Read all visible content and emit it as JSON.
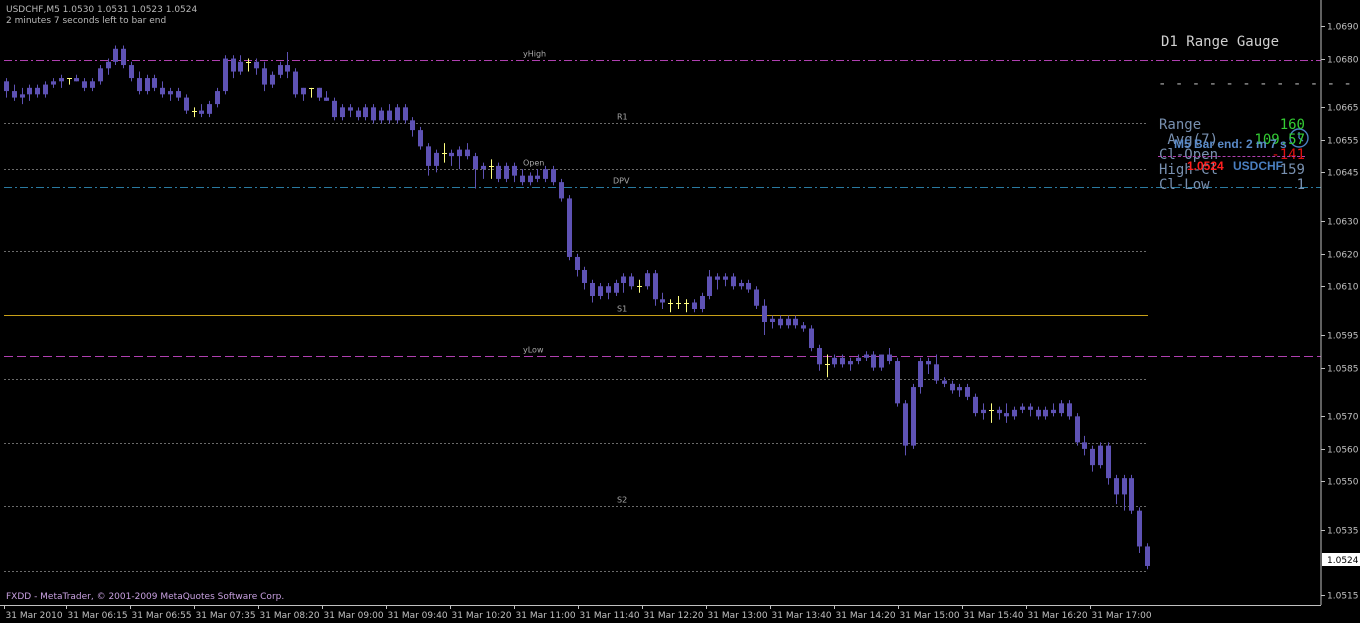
{
  "header": {
    "symbol_line": "USDCHF,M5  1.0530 1.0531 1.0523 1.0524",
    "countdown": "2 minutes 7 seconds left to bar end"
  },
  "footer": {
    "copyright": "FXDD - MetaTrader, © 2001-2009 MetaQuotes Software Corp."
  },
  "gauge": {
    "title": "D1 Range Gauge",
    "rows": [
      {
        "label": "Range",
        "value": "160",
        "color": "#33cc33"
      },
      {
        "label": " Avg(7)",
        "value": "109.57",
        "color": "#33cc33"
      },
      {
        "label": "Cl-Open",
        "value": "-141",
        "color": "#e01010",
        "strike": true
      },
      {
        "label": "High-Cl",
        "value": "159",
        "color": "#7890b0"
      },
      {
        "label": "Cl-Low",
        "value": "1",
        "color": "#7890b0"
      }
    ]
  },
  "bar_info": {
    "bar_end": "M5 Bar end: 2 m 7 s",
    "price": "1.0524",
    "symbol": "USDCHF",
    "clock_icon": "clock-icon"
  },
  "colors": {
    "background": "#000000",
    "candle": "#5e52b4",
    "doji": "#ffff80",
    "grid": "#6a6a6a",
    "pivot": "#c8a018",
    "range_line": "#b040b0",
    "dpv_line": "#2a7aa0",
    "axis": "#c0c0c0"
  },
  "chart_data": {
    "type": "candlestick",
    "timeframe": "M5",
    "symbol": "USDCHF",
    "ylim": [
      1.0512,
      1.0698
    ],
    "y_ticks": [
      "1.0690",
      "1.0680",
      "1.0665",
      "1.0655",
      "1.0645",
      "1.0630",
      "1.0620",
      "1.0610",
      "1.0595",
      "1.0585",
      "1.0570",
      "1.0560",
      "1.0550",
      "1.0535",
      "1.0515"
    ],
    "current_price": "1.0524",
    "x_tick_labels": [
      "31 Mar 2010",
      "31 Mar 06:15",
      "31 Mar 06:55",
      "31 Mar 07:35",
      "31 Mar 08:20",
      "31 Mar 09:00",
      "31 Mar 09:40",
      "31 Mar 10:20",
      "31 Mar 11:00",
      "31 Mar 11:40",
      "31 Mar 12:20",
      "31 Mar 13:00",
      "31 Mar 13:40",
      "31 Mar 14:20",
      "31 Mar 15:00",
      "31 Mar 15:40",
      "31 Mar 16:20",
      "31 Mar 17:00"
    ],
    "levels": [
      {
        "label": "R1",
        "price": 1.06602,
        "style": "dotted",
        "color": "#6a6a6a"
      },
      {
        "label": "yHigh",
        "price": 1.06795,
        "style": "dashdot",
        "color": "#b040b0"
      },
      {
        "label": "Open",
        "price": 1.0646,
        "style": "dotted",
        "color": "#6a6a6a"
      },
      {
        "label": "DPV",
        "price": 1.06405,
        "style": "dashdot",
        "color": "#2a7aa0"
      },
      {
        "label": "",
        "price": 1.06208,
        "style": "dotted",
        "color": "#6a6a6a"
      },
      {
        "label": "S1",
        "price": 1.06012,
        "style": "solid",
        "color": "#c8a018"
      },
      {
        "label": "yLow",
        "price": 1.05885,
        "style": "dashed",
        "color": "#b040b0"
      },
      {
        "label": "",
        "price": 1.05815,
        "style": "dotted",
        "color": "#6a6a6a"
      },
      {
        "label": "",
        "price": 1.05617,
        "style": "dotted",
        "color": "#6a6a6a"
      },
      {
        "label": "S2",
        "price": 1.05423,
        "style": "dotted",
        "color": "#6a6a6a"
      },
      {
        "label": "",
        "price": 1.05225,
        "style": "dotted",
        "color": "#6a6a6a"
      }
    ],
    "candles": [
      [
        1.0673,
        1.0674,
        1.0668,
        1.067
      ],
      [
        1.067,
        1.0672,
        1.0667,
        1.0668
      ],
      [
        1.0668,
        1.0671,
        1.0666,
        1.0669
      ],
      [
        1.0669,
        1.0672,
        1.0667,
        1.0671
      ],
      [
        1.0671,
        1.0672,
        1.0668,
        1.0669
      ],
      [
        1.0669,
        1.0673,
        1.0668,
        1.0672
      ],
      [
        1.0672,
        1.0674,
        1.0671,
        1.0673
      ],
      [
        1.0673,
        1.0675,
        1.0671,
        1.0674
      ],
      [
        1.0674,
        1.0674,
        1.0672,
        1.0674
      ],
      [
        1.0674,
        1.0675,
        1.0673,
        1.0673
      ],
      [
        1.0673,
        1.0674,
        1.067,
        1.0671
      ],
      [
        1.0671,
        1.0674,
        1.067,
        1.0673
      ],
      [
        1.0673,
        1.0678,
        1.0672,
        1.0677
      ],
      [
        1.0677,
        1.068,
        1.0675,
        1.0679
      ],
      [
        1.0679,
        1.0684,
        1.0678,
        1.0683
      ],
      [
        1.0683,
        1.0684,
        1.0677,
        1.0678
      ],
      [
        1.0678,
        1.0679,
        1.0673,
        1.0674
      ],
      [
        1.0674,
        1.0676,
        1.0669,
        1.067
      ],
      [
        1.067,
        1.0675,
        1.0669,
        1.0674
      ],
      [
        1.0674,
        1.0675,
        1.067,
        1.0671
      ],
      [
        1.0671,
        1.0673,
        1.0668,
        1.0669
      ],
      [
        1.0669,
        1.0671,
        1.0667,
        1.067
      ],
      [
        1.067,
        1.0671,
        1.0667,
        1.0668
      ],
      [
        1.0668,
        1.0669,
        1.0663,
        1.0664
      ],
      [
        1.0664,
        1.0665,
        1.0662,
        1.0664
      ],
      [
        1.0664,
        1.0666,
        1.0662,
        1.0663
      ],
      [
        1.0663,
        1.0667,
        1.0662,
        1.0666
      ],
      [
        1.0666,
        1.0671,
        1.0665,
        1.067
      ],
      [
        1.067,
        1.0681,
        1.0669,
        1.068
      ],
      [
        1.068,
        1.0681,
        1.0674,
        1.0676
      ],
      [
        1.0676,
        1.0681,
        1.0675,
        1.0679
      ],
      [
        1.0679,
        1.068,
        1.0676,
        1.0679
      ],
      [
        1.0679,
        1.068,
        1.0675,
        1.0677
      ],
      [
        1.0677,
        1.0679,
        1.067,
        1.0672
      ],
      [
        1.0672,
        1.0676,
        1.0671,
        1.0675
      ],
      [
        1.0675,
        1.0679,
        1.0674,
        1.0678
      ],
      [
        1.0678,
        1.0682,
        1.0674,
        1.0676
      ],
      [
        1.0676,
        1.0677,
        1.0668,
        1.0669
      ],
      [
        1.0669,
        1.0671,
        1.0667,
        1.0671
      ],
      [
        1.0671,
        1.0671,
        1.0668,
        1.0671
      ],
      [
        1.0671,
        1.0671,
        1.0667,
        1.0668
      ],
      [
        1.0668,
        1.067,
        1.0667,
        1.0667
      ],
      [
        1.0667,
        1.0668,
        1.0661,
        1.0662
      ],
      [
        1.0662,
        1.0666,
        1.0661,
        1.0665
      ],
      [
        1.0665,
        1.0666,
        1.0662,
        1.0664
      ],
      [
        1.0664,
        1.0665,
        1.0661,
        1.0662
      ],
      [
        1.0662,
        1.0666,
        1.0661,
        1.0665
      ],
      [
        1.0665,
        1.0666,
        1.066,
        1.0661
      ],
      [
        1.0661,
        1.0665,
        1.066,
        1.0664
      ],
      [
        1.0664,
        1.0666,
        1.066,
        1.0661
      ],
      [
        1.0661,
        1.0666,
        1.066,
        1.0665
      ],
      [
        1.0665,
        1.0666,
        1.066,
        1.0661
      ],
      [
        1.0661,
        1.0662,
        1.0656,
        1.0658
      ],
      [
        1.0658,
        1.0659,
        1.0652,
        1.0653
      ],
      [
        1.0653,
        1.0654,
        1.0644,
        1.0647
      ],
      [
        1.0647,
        1.0652,
        1.0645,
        1.0651
      ],
      [
        1.0651,
        1.0654,
        1.0648,
        1.0651
      ],
      [
        1.0651,
        1.0652,
        1.0647,
        1.065
      ],
      [
        1.065,
        1.0653,
        1.0646,
        1.0652
      ],
      [
        1.0652,
        1.0654,
        1.0649,
        1.065
      ],
      [
        1.065,
        1.0651,
        1.064,
        1.0646
      ],
      [
        1.0646,
        1.0648,
        1.0643,
        1.0647
      ],
      [
        1.0647,
        1.0649,
        1.0643,
        1.0647
      ],
      [
        1.0647,
        1.0648,
        1.0642,
        1.0643
      ],
      [
        1.0643,
        1.0648,
        1.0642,
        1.0647
      ],
      [
        1.0647,
        1.0648,
        1.0642,
        1.0644
      ],
      [
        1.0644,
        1.0646,
        1.0641,
        1.0642
      ],
      [
        1.0642,
        1.0645,
        1.0641,
        1.0644
      ],
      [
        1.0644,
        1.0646,
        1.0642,
        1.0643
      ],
      [
        1.0643,
        1.0647,
        1.0642,
        1.0646
      ],
      [
        1.0646,
        1.0647,
        1.0641,
        1.0642
      ],
      [
        1.0642,
        1.0643,
        1.0636,
        1.0637
      ],
      [
        1.0637,
        1.0638,
        1.0618,
        1.0619
      ],
      [
        1.0619,
        1.062,
        1.0613,
        1.0615
      ],
      [
        1.0615,
        1.0616,
        1.0609,
        1.0611
      ],
      [
        1.0611,
        1.0612,
        1.0605,
        1.0607
      ],
      [
        1.0607,
        1.0611,
        1.0606,
        1.061
      ],
      [
        1.061,
        1.0611,
        1.0606,
        1.0608
      ],
      [
        1.0608,
        1.0612,
        1.0607,
        1.0611
      ],
      [
        1.0611,
        1.0614,
        1.0608,
        1.0613
      ],
      [
        1.0613,
        1.0614,
        1.0609,
        1.061
      ],
      [
        1.061,
        1.0612,
        1.0608,
        1.061
      ],
      [
        1.061,
        1.0615,
        1.0609,
        1.0614
      ],
      [
        1.0614,
        1.0615,
        1.0604,
        1.0606
      ],
      [
        1.0606,
        1.0608,
        1.0603,
        1.0605
      ],
      [
        1.0605,
        1.0606,
        1.0602,
        1.0605
      ],
      [
        1.0605,
        1.0607,
        1.0603,
        1.0605
      ],
      [
        1.0605,
        1.0606,
        1.0602,
        1.0605
      ],
      [
        1.0605,
        1.0606,
        1.0602,
        1.0603
      ],
      [
        1.0603,
        1.0608,
        1.0602,
        1.0607
      ],
      [
        1.0607,
        1.0615,
        1.0606,
        1.0613
      ],
      [
        1.0613,
        1.0614,
        1.0609,
        1.0612
      ],
      [
        1.0612,
        1.0614,
        1.061,
        1.0613
      ],
      [
        1.0613,
        1.0614,
        1.0609,
        1.061
      ],
      [
        1.061,
        1.0612,
        1.0609,
        1.0611
      ],
      [
        1.0611,
        1.0612,
        1.0608,
        1.0609
      ],
      [
        1.0609,
        1.061,
        1.0603,
        1.0604
      ],
      [
        1.0604,
        1.0606,
        1.0595,
        1.0599
      ],
      [
        1.0599,
        1.0601,
        1.0597,
        1.06
      ],
      [
        1.06,
        1.0601,
        1.0597,
        1.0598
      ],
      [
        1.0598,
        1.0601,
        1.0597,
        1.06
      ],
      [
        1.06,
        1.0601,
        1.0597,
        1.0598
      ],
      [
        1.0598,
        1.0599,
        1.0596,
        1.0597
      ],
      [
        1.0597,
        1.0598,
        1.059,
        1.0591
      ],
      [
        1.0591,
        1.0592,
        1.0584,
        1.0586
      ],
      [
        1.0586,
        1.0589,
        1.0582,
        1.0586
      ],
      [
        1.0586,
        1.0589,
        1.0585,
        1.0588
      ],
      [
        1.0588,
        1.0589,
        1.0585,
        1.0586
      ],
      [
        1.0586,
        1.0588,
        1.0584,
        1.0587
      ],
      [
        1.0587,
        1.0589,
        1.0586,
        1.0588
      ],
      [
        1.0588,
        1.059,
        1.0587,
        1.0589
      ],
      [
        1.0589,
        1.059,
        1.0584,
        1.0585
      ],
      [
        1.0585,
        1.0589,
        1.0584,
        1.0589
      ],
      [
        1.0589,
        1.0591,
        1.0586,
        1.0587
      ],
      [
        1.0587,
        1.0588,
        1.0573,
        1.0574
      ],
      [
        1.0574,
        1.0575,
        1.0558,
        1.0561
      ],
      [
        1.0561,
        1.058,
        1.056,
        1.0579
      ],
      [
        1.0579,
        1.0588,
        1.0577,
        1.0587
      ],
      [
        1.0587,
        1.0588,
        1.0583,
        1.0586
      ],
      [
        1.0586,
        1.0589,
        1.058,
        1.0581
      ],
      [
        1.0581,
        1.0582,
        1.0579,
        1.058
      ],
      [
        1.058,
        1.0581,
        1.0577,
        1.0578
      ],
      [
        1.0578,
        1.058,
        1.0576,
        1.0579
      ],
      [
        1.0579,
        1.058,
        1.0575,
        1.0576
      ],
      [
        1.0576,
        1.0577,
        1.057,
        1.0571
      ],
      [
        1.0571,
        1.0574,
        1.0569,
        1.0572
      ],
      [
        1.0572,
        1.0574,
        1.0568,
        1.0572
      ],
      [
        1.0572,
        1.0573,
        1.0569,
        1.0571
      ],
      [
        1.0571,
        1.0574,
        1.0568,
        1.057
      ],
      [
        1.057,
        1.0573,
        1.0569,
        1.0572
      ],
      [
        1.0572,
        1.0574,
        1.0571,
        1.0573
      ],
      [
        1.0573,
        1.0574,
        1.057,
        1.0572
      ],
      [
        1.0572,
        1.0573,
        1.0569,
        1.057
      ],
      [
        1.057,
        1.0573,
        1.0569,
        1.0572
      ],
      [
        1.0572,
        1.0574,
        1.057,
        1.0571
      ],
      [
        1.0571,
        1.0575,
        1.057,
        1.0574
      ],
      [
        1.0574,
        1.0575,
        1.0569,
        1.057
      ],
      [
        1.057,
        1.0571,
        1.0561,
        1.0562
      ],
      [
        1.0562,
        1.0564,
        1.0558,
        1.056
      ],
      [
        1.056,
        1.0561,
        1.0553,
        1.0555
      ],
      [
        1.0555,
        1.0562,
        1.0554,
        1.0561
      ],
      [
        1.0561,
        1.0562,
        1.0549,
        1.0551
      ],
      [
        1.0551,
        1.0552,
        1.0543,
        1.0546
      ],
      [
        1.0546,
        1.0552,
        1.0541,
        1.0551
      ],
      [
        1.0551,
        1.0552,
        1.054,
        1.0541
      ],
      [
        1.0541,
        1.0542,
        1.0528,
        1.053
      ],
      [
        1.053,
        1.0531,
        1.0523,
        1.0524
      ]
    ]
  }
}
